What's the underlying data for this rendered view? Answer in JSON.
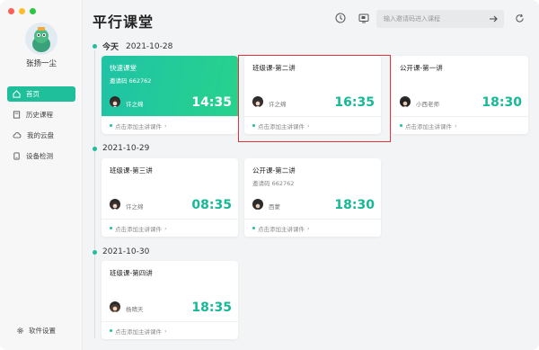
{
  "app": {
    "title": "平行课堂"
  },
  "user": {
    "name": "张扬一尘"
  },
  "sidebar": {
    "items": [
      {
        "label": "首页",
        "icon": "home-icon"
      },
      {
        "label": "历史课程",
        "icon": "book-icon"
      },
      {
        "label": "我的云盘",
        "icon": "cloud-icon"
      },
      {
        "label": "设备检测",
        "icon": "device-icon"
      }
    ],
    "settings_label": "软件设置"
  },
  "header": {
    "search": {
      "placeholder": "输入邀请码进入课程"
    }
  },
  "days": [
    {
      "label": "今天",
      "date": "2021-10-28",
      "cards": [
        {
          "title": "快速课堂",
          "code": "邀请码 662762",
          "teacher": "许之绵",
          "time": "14:35",
          "action": "点击添加主讲课件"
        },
        {
          "title": "班级课-第二讲",
          "code": "",
          "teacher": "许之绵",
          "time": "16:35",
          "action": "点击添加主讲课件"
        },
        {
          "title": "公开课-第一讲",
          "code": "",
          "teacher": "小西老师",
          "time": "18:30",
          "action": "点击添加主讲课件"
        }
      ]
    },
    {
      "date": "2021-10-29",
      "cards": [
        {
          "title": "班级课-第三讲",
          "code": "",
          "teacher": "许之绵",
          "time": "08:35",
          "action": "点击添加主讲课件"
        },
        {
          "title": "公开课-第二讲",
          "code": "邀请码 662762",
          "teacher": "西蒙",
          "time": "18:30",
          "action": "点击添加主讲课件"
        }
      ]
    },
    {
      "date": "2021-10-30",
      "cards": [
        {
          "title": "班级课-第四讲",
          "code": "",
          "teacher": "杨晴天",
          "time": "18:35",
          "action": "点击添加主讲课件"
        }
      ]
    }
  ],
  "colors": {
    "accent": "#1fbf9c",
    "highlight": "#e0333a"
  }
}
